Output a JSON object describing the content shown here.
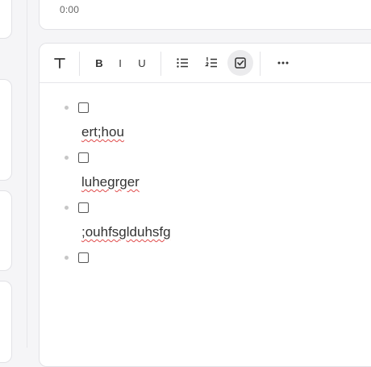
{
  "audio": {
    "time": "0:00"
  },
  "toolbar": {
    "text_style": "text-style",
    "bold_label": "B",
    "italic_label": "I",
    "underline_label": "U"
  },
  "checklist": {
    "items": [
      {
        "text": "ert;hou",
        "checked": false
      },
      {
        "text": "luhegrger",
        "checked": false
      },
      {
        "text": ";ouhfsglduhsfg",
        "checked": false
      },
      {
        "text": "",
        "checked": false
      }
    ]
  }
}
